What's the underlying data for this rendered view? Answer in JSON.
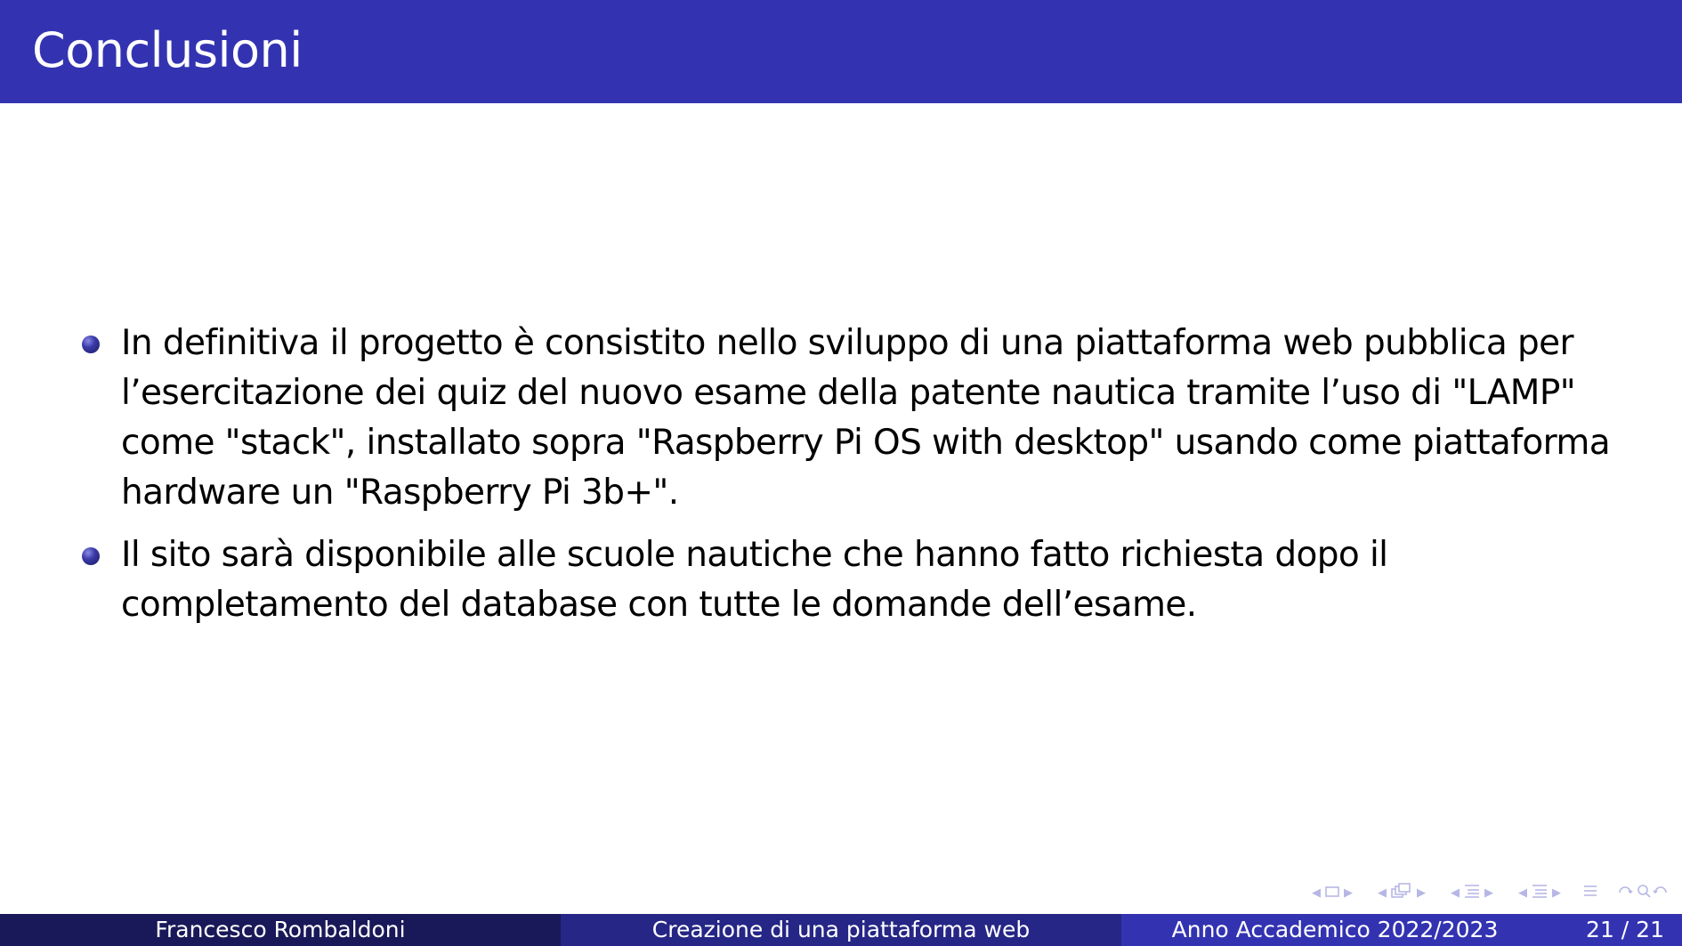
{
  "slide": {
    "title": "Conclusioni",
    "bullets": [
      "In definitiva il progetto è consistito nello sviluppo di una piattaforma web pubblica per l’esercitazione dei quiz del nuovo esame della patente nautica tramite l’uso di \"LAMP\" come \"stack\", installato sopra \"Raspberry Pi OS with desktop\" usando come piattaforma hardware un \"Raspberry Pi 3b+\".",
      "Il sito sarà disponibile alle scuole nautiche che hanno fatto richiesta dopo il completamento del database con tutte le domande dell’esame."
    ]
  },
  "footer": {
    "author": "Francesco Rombaldoni",
    "short_title": "Creazione di una piattaforma web",
    "date": "Anno Accademico 2022/2023",
    "page": "21 / 21"
  },
  "navigation": {
    "icons": [
      "frame-nav-icon",
      "subsection-nav-icon",
      "section-nav-icon",
      "document-nav-icon",
      "align-icon",
      "search-icon"
    ]
  },
  "colors": {
    "title_bar": "#3333b2",
    "footer_author": "#191959",
    "footer_title": "#262686",
    "footer_right": "#3333b2",
    "nav": "#b7b7e6"
  }
}
